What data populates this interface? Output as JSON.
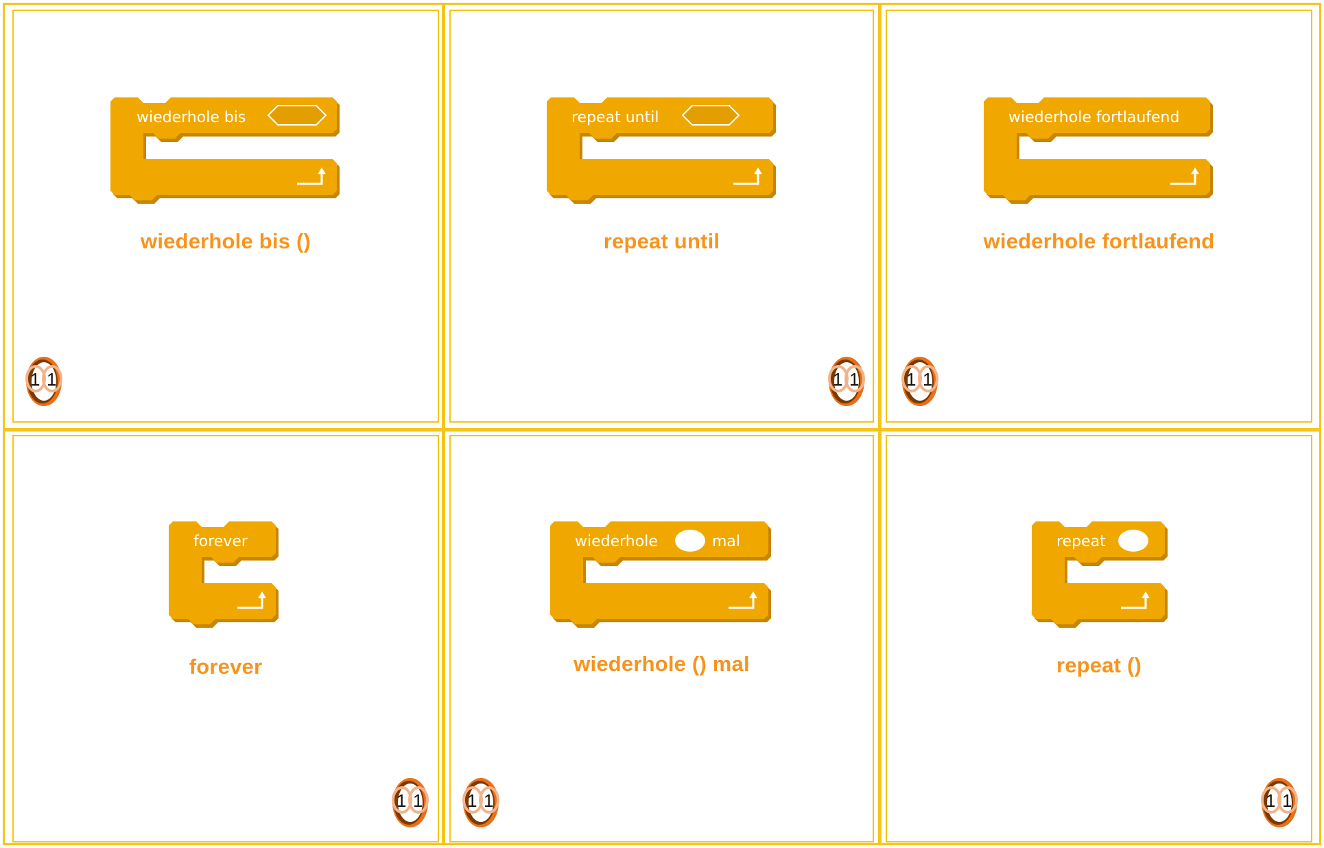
{
  "colors": {
    "card_border": "#f5c518",
    "block_fill": "#f0a800",
    "block_shadow": "#c78500",
    "caption": "#f7941d",
    "badge_outer": "#e8701a",
    "badge_dark": "#7a3a00",
    "badge_inner_ring": "#f3b38a"
  },
  "cards": [
    {
      "block_label": "wiederhole bis",
      "block_input": "boolean",
      "caption": "wiederhole bis ()",
      "badge": {
        "left": "1",
        "right": "1",
        "icon": "card-number-badge-icon"
      }
    },
    {
      "block_label": "repeat until",
      "block_input": "boolean",
      "caption": "repeat until",
      "badge": {
        "left": "1",
        "right": "1",
        "icon": "card-number-badge-icon"
      }
    },
    {
      "block_label": "wiederhole fortlaufend",
      "block_input": "none",
      "caption": "wiederhole fortlaufend",
      "badge": {
        "left": "1",
        "right": "1",
        "icon": "card-number-badge-icon"
      }
    },
    {
      "block_label": "forever",
      "block_input": "none",
      "caption": "forever",
      "badge": {
        "left": "1",
        "right": "1",
        "icon": "card-number-badge-icon"
      }
    },
    {
      "block_label": "wiederhole",
      "block_label_after": "mal",
      "block_input": "number",
      "caption": "wiederhole () mal",
      "badge": {
        "left": "1",
        "right": "1",
        "icon": "card-number-badge-icon"
      }
    },
    {
      "block_label": "repeat",
      "block_input": "number",
      "caption": "repeat ()",
      "badge": {
        "left": "1",
        "right": "1",
        "icon": "card-number-badge-icon"
      }
    }
  ],
  "icons": {
    "loop_arrow": "loop-arrow-icon",
    "boolean_slot": "boolean-slot-icon",
    "number_slot": "number-slot-icon"
  }
}
